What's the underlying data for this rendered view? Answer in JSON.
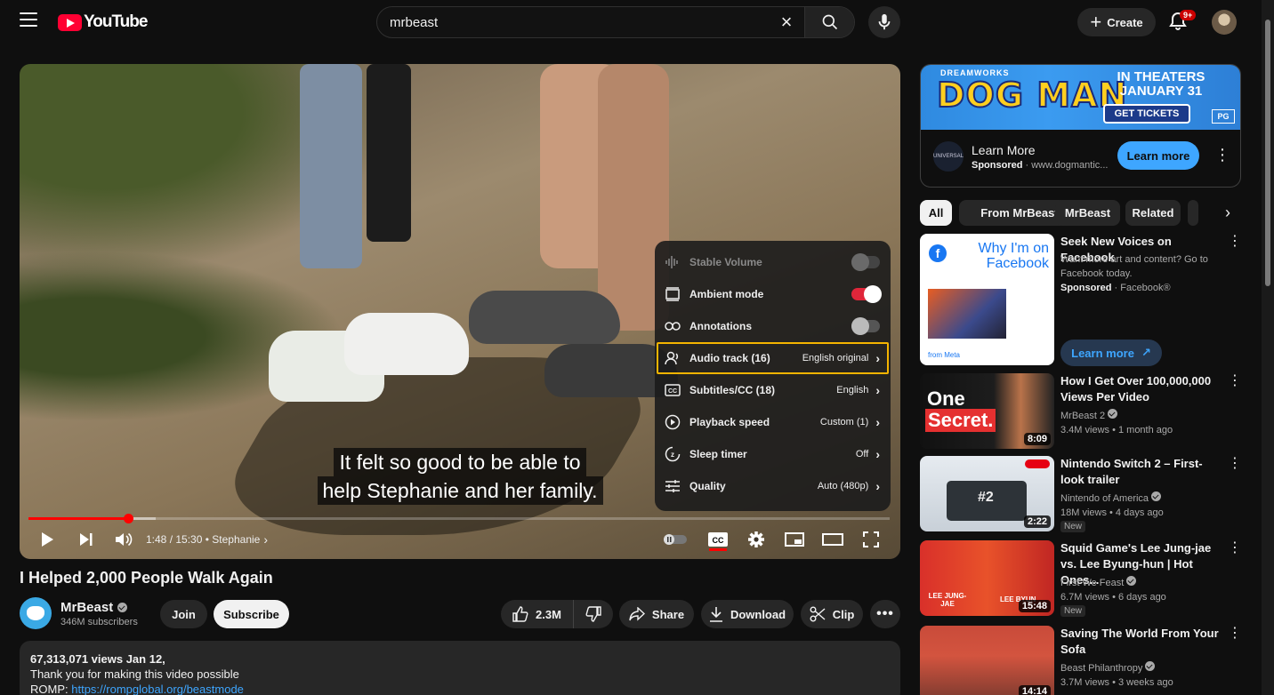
{
  "header": {
    "logo_text": "YouTube",
    "search_value": "mrbeast",
    "create_label": "Create",
    "notifications_badge": "9+"
  },
  "player": {
    "caption_lines": [
      "It felt so good to be able to",
      "help Stephanie and her family."
    ],
    "current_time": "1:48",
    "duration": "15:30",
    "chapter": "Stephanie",
    "progress_fraction": 0.116,
    "buffered_fraction": 0.148,
    "settings_menu": [
      {
        "label": "Stable Volume",
        "type": "toggle",
        "state": "off",
        "disabled": true,
        "icon": "stable-volume-icon"
      },
      {
        "label": "Ambient mode",
        "type": "toggle",
        "state": "on",
        "disabled": false,
        "icon": "ambient-mode-icon"
      },
      {
        "label": "Annotations",
        "type": "toggle",
        "state": "off",
        "disabled": false,
        "icon": "annotations-icon"
      },
      {
        "label": "Audio track (16)",
        "type": "submenu",
        "value": "English original",
        "focused": true,
        "icon": "audio-track-icon"
      },
      {
        "label": "Subtitles/CC (18)",
        "type": "submenu",
        "value": "English",
        "icon": "subtitles-icon"
      },
      {
        "label": "Playback speed",
        "type": "submenu",
        "value": "Custom (1)",
        "icon": "playback-speed-icon"
      },
      {
        "label": "Sleep timer",
        "type": "submenu",
        "value": "Off",
        "icon": "sleep-timer-icon"
      },
      {
        "label": "Quality",
        "type": "submenu",
        "value": "Auto (480p)",
        "icon": "quality-icon"
      }
    ]
  },
  "video": {
    "title": "I Helped 2,000 People Walk Again",
    "channel": "MrBeast",
    "subscribers": "346M subscribers",
    "join_label": "Join",
    "subscribe_label": "Subscribe",
    "likes": "2.3M",
    "share_label": "Share",
    "download_label": "Download",
    "clip_label": "Clip"
  },
  "description": {
    "stats": "67,313,071 views  Jan 12,",
    "line1": "Thank you for making this video possible",
    "line2_prefix": "ROMP: ",
    "line2_link": "https://rompglobal.org/beastmode"
  },
  "ad": {
    "brand_top": "DREAMWORKS",
    "banner_title": "DOG MAN",
    "banner_dates": "IN THEATERS JANUARY 31",
    "banner_cta": "GET TICKETS",
    "rating": "PG",
    "logo_text": "UNIVERSAL",
    "title": "Learn More",
    "sponsored": "Sponsored",
    "domain": " · www.dogmantic...",
    "cta": "Learn more"
  },
  "chips": [
    "All",
    "From MrBeast",
    "MrBeast",
    "Related"
  ],
  "recommendations": [
    {
      "title": "Seek New Voices on Facebook",
      "desc": "Want more art and content? Go to Facebook today.",
      "sponsored": "Sponsored",
      "advertiser": " · Facebook®",
      "cta": "Learn more",
      "thumb_text": "Why I'm on Facebook",
      "meta_brand": "from Meta"
    },
    {
      "title": "How I Get Over 100,000,000 Views Per Video",
      "channel": "MrBeast 2",
      "meta": "3.4M views • 1 month ago",
      "duration": "8:09",
      "thumb_text_1": "One",
      "thumb_text_2": "Secret."
    },
    {
      "title": "Nintendo Switch 2 – First-look trailer",
      "channel": "Nintendo of America",
      "meta": "18M views • 4 days ago",
      "duration": "2:22",
      "badge": "New",
      "thumb_text": "#2"
    },
    {
      "title": "Squid Game's Lee Jung-jae vs. Lee Byung-hun | Hot Ones...",
      "channel": "First We Feast",
      "meta": "6.7M views • 6 days ago",
      "duration": "15:48",
      "badge": "New",
      "thumb_text_1": "LEE JUNG-JAE",
      "thumb_text_2": "LEE BYUN"
    },
    {
      "title": "Saving The World From Your Sofa",
      "channel": "Beast Philanthropy",
      "meta": "3.7M views • 3 weeks ago",
      "duration": "14:14"
    }
  ]
}
